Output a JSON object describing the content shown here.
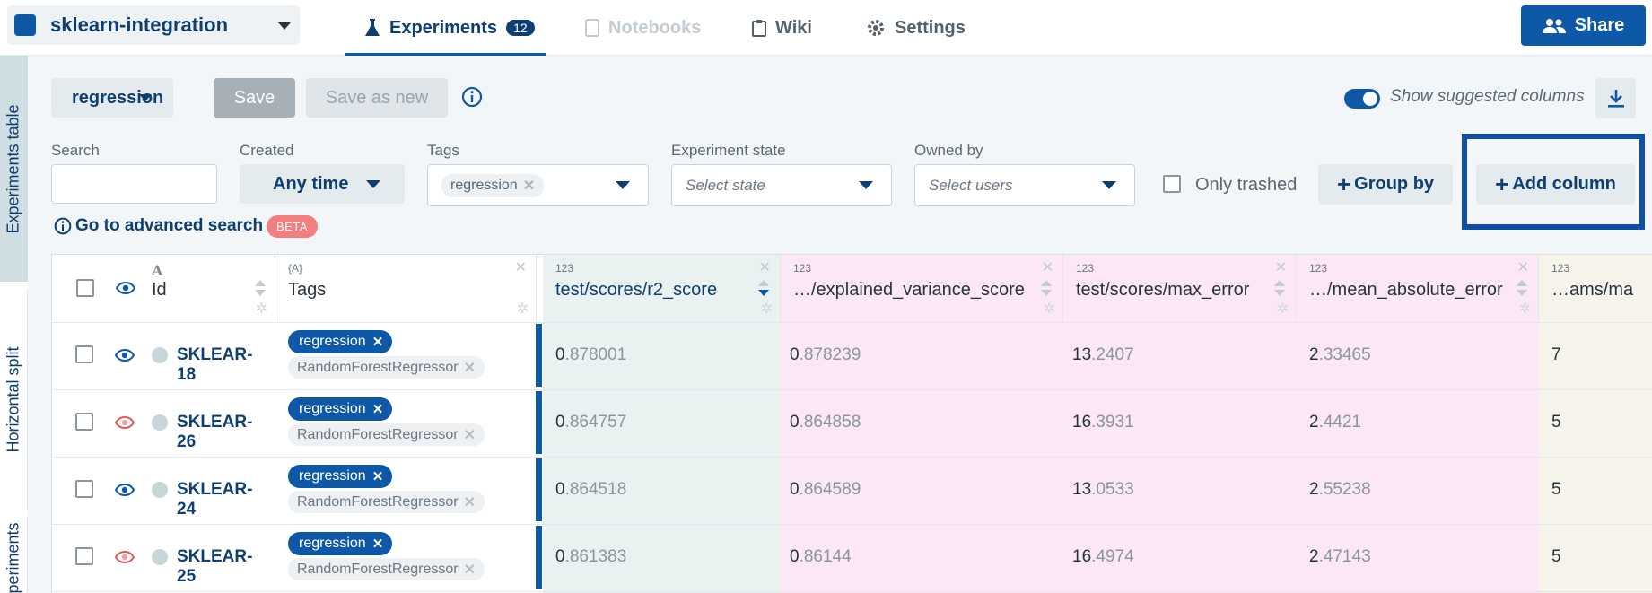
{
  "project": {
    "name": "sklearn-integration"
  },
  "tabs": [
    {
      "label": "Experiments",
      "badge": "12"
    },
    {
      "label": "Notebooks"
    },
    {
      "label": "Wiki"
    },
    {
      "label": "Settings"
    }
  ],
  "share_label": "Share",
  "side_tabs": [
    "Experiments table",
    "Horizontal split",
    "Experiments"
  ],
  "toolbar": {
    "view": "regression",
    "save": "Save",
    "save_as_new": "Save as new",
    "suggested_label": "Show suggested columns",
    "suggested_on": true
  },
  "filters": {
    "search_label": "Search",
    "search_value": "",
    "created_label": "Created",
    "created_value": "Any time",
    "tags_label": "Tags",
    "tags_value": "regression",
    "state_label": "Experiment state",
    "state_placeholder": "Select state",
    "owner_label": "Owned by",
    "owner_placeholder": "Select users",
    "only_trashed": "Only trashed",
    "group_by": "Group by",
    "add_column": "Add column",
    "advanced_search": "Go to advanced search",
    "beta": "BETA"
  },
  "columns": [
    {
      "type": "A",
      "title": "Id"
    },
    {
      "type": "{A}",
      "title": "Tags"
    },
    {
      "type": "123",
      "title": "test/scores/r2_score"
    },
    {
      "type": "123",
      "title": "…/explained_variance_score"
    },
    {
      "type": "123",
      "title": "test/scores/max_error"
    },
    {
      "type": "123",
      "title": "…/mean_absolute_error"
    },
    {
      "type": "123",
      "title": "…ams/ma"
    }
  ],
  "rows": [
    {
      "id": "SKLEAR-18",
      "eye": "visible",
      "tags": [
        "regression",
        "RandomForestRegressor"
      ],
      "r2": [
        "0",
        ".878001"
      ],
      "evs": [
        "0",
        ".878239"
      ],
      "maxerr": [
        "13",
        ".2407"
      ],
      "mae": [
        "2",
        ".33465"
      ],
      "last": "7"
    },
    {
      "id": "SKLEAR-26",
      "eye": "hidden",
      "tags": [
        "regression",
        "RandomForestRegressor"
      ],
      "r2": [
        "0",
        ".864757"
      ],
      "evs": [
        "0",
        ".864858"
      ],
      "maxerr": [
        "16",
        ".3931"
      ],
      "mae": [
        "2",
        ".4421"
      ],
      "last": "5"
    },
    {
      "id": "SKLEAR-24",
      "eye": "visible",
      "tags": [
        "regression",
        "RandomForestRegressor"
      ],
      "r2": [
        "0",
        ".864518"
      ],
      "evs": [
        "0",
        ".864589"
      ],
      "maxerr": [
        "13",
        ".0533"
      ],
      "mae": [
        "2",
        ".55238"
      ],
      "last": "5"
    },
    {
      "id": "SKLEAR-25",
      "eye": "hidden",
      "tags": [
        "regression",
        "RandomForestRegressor"
      ],
      "r2": [
        "0",
        ".861383"
      ],
      "evs": [
        "0",
        ".86144"
      ],
      "maxerr": [
        "16",
        ".4974"
      ],
      "mae": [
        "2",
        ".47143"
      ],
      "last": "5"
    }
  ],
  "colors": {
    "brand": "#0e58a8",
    "brand_dark": "#0e3f73",
    "teal_col": "#e9f1f1",
    "pink_col": "#fbe7f5",
    "beta": "#f27f7f",
    "eye_hidden": "#e05a5a"
  }
}
